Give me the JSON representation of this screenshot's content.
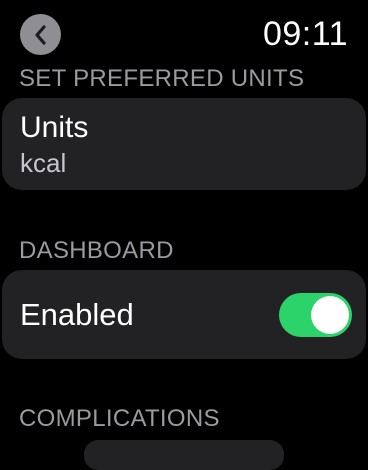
{
  "status_bar": {
    "time": "09:11",
    "back_icon": "chevron-left-icon"
  },
  "sections": {
    "units_header": "SET PREFERRED UNITS",
    "units": {
      "title": "Units",
      "value": "kcal"
    },
    "dashboard_header": "DASHBOARD",
    "dashboard": {
      "label": "Enabled",
      "toggle_on": true
    },
    "complications_header": "COMPLICATIONS"
  },
  "colors": {
    "background": "#000000",
    "card": "#222224",
    "header_text": "#9a9aa0",
    "toggle_on": "#2bd36a",
    "back_button": "#8e8e93"
  }
}
